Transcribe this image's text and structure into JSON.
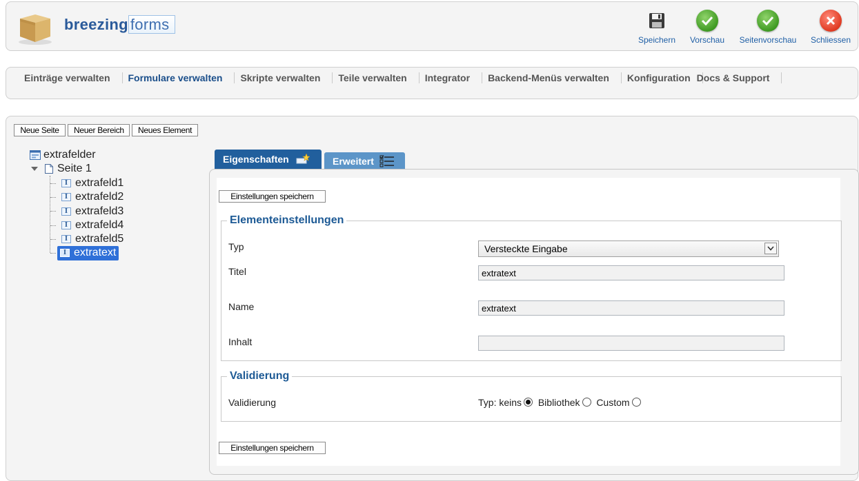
{
  "header": {
    "logo_bold": "breezing",
    "logo_light": "forms",
    "toolbar": [
      {
        "label": "Speichern",
        "icon": "floppy-disk-icon"
      },
      {
        "label": "Vorschau",
        "icon": "check-icon"
      },
      {
        "label": "Seitenvorschau",
        "icon": "check-icon"
      },
      {
        "label": "Schliessen",
        "icon": "close-icon"
      }
    ]
  },
  "nav": {
    "items": [
      {
        "label": "Einträge verwalten"
      },
      {
        "label": "Formulare verwalten",
        "active": true
      },
      {
        "label": "Skripte verwalten"
      },
      {
        "label": "Teile verwalten"
      },
      {
        "label": "Integrator"
      },
      {
        "label": "Backend-Menüs verwalten"
      },
      {
        "label": "Konfiguration"
      },
      {
        "label": "Docs & Support"
      }
    ]
  },
  "actions": {
    "new_page": "Neue Seite",
    "new_section": "Neuer Bereich",
    "new_element": "Neues Element"
  },
  "tree": {
    "root": "extrafelder",
    "page": "Seite 1",
    "children": [
      "extrafeld1",
      "extrafeld2",
      "extrafeld3",
      "extrafeld4",
      "extrafeld5",
      "extratext"
    ],
    "selected": "extratext"
  },
  "tabs": {
    "properties": "Eigenschaften",
    "advanced": "Erweitert"
  },
  "form": {
    "save_label": "Einstellungen speichern",
    "element_settings_legend": "Elementeinstellungen",
    "type_label": "Typ",
    "type_value": "Versteckte Eingabe",
    "title_label": "Titel",
    "title_value": "extratext",
    "name_label": "Name",
    "name_value": "extratext",
    "content_label": "Inhalt",
    "content_value": "",
    "validation_legend": "Validierung",
    "validation_label": "Validierung",
    "validation_prefix": "Typ:",
    "validation_options": [
      "keins",
      "Bibliothek",
      "Custom"
    ],
    "validation_selected": "keins"
  }
}
